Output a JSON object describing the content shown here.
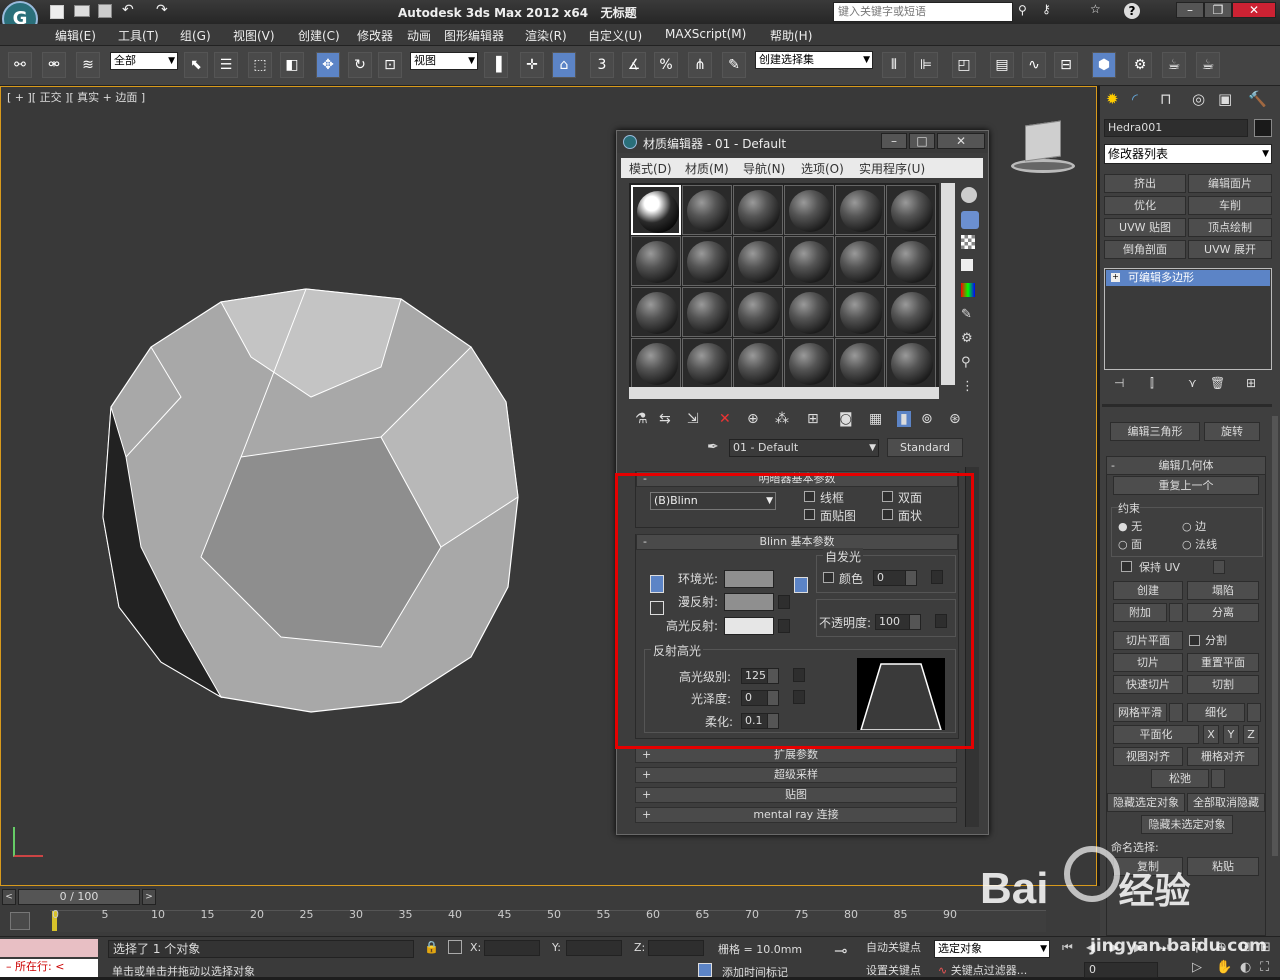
{
  "titlebar": {
    "title": "Autodesk 3ds Max  2012 x64",
    "file": "无标题",
    "search_placeholder": "键入关键字或短语",
    "help": "?"
  },
  "menu": [
    "编辑(E)",
    "工具(T)",
    "组(G)",
    "视图(V)",
    "创建(C)",
    "修改器",
    "动画",
    "图形编辑器",
    "渲染(R)",
    "自定义(U)",
    "MAXScript(M)",
    "帮助(H)"
  ],
  "toolbar": {
    "selection_filter": "全部",
    "ref_coord": "视图",
    "named_set": "创建选择集",
    "snap3": "3",
    "snap_pct": "%"
  },
  "viewport": {
    "label": "[ + ][ 正交 ][ 真实 + 边面 ]"
  },
  "mat_editor": {
    "title": "材质编辑器 - 01 - Default",
    "menu": [
      "模式(D)",
      "材质(M)",
      "导航(N)",
      "选项(O)",
      "实用程序(U)"
    ],
    "material_name": "01 - Default",
    "material_type": "Standard",
    "rollout_shader": "明暗器基本参数",
    "shader": "(B)Blinn",
    "wire": "线框",
    "two_sided": "双面",
    "face_map": "面贴图",
    "faceted": "面状",
    "rollout_blinn": "Blinn 基本参数",
    "self_illum": "自发光",
    "color": "颜色",
    "color_val": "0",
    "ambient": "环境光:",
    "diffuse": "漫反射:",
    "specular": "高光反射:",
    "opacity": "不透明度:",
    "opacity_val": "100",
    "spec_highlights": "反射高光",
    "spec_level": "高光级别:",
    "spec_level_val": "125",
    "gloss": "光泽度:",
    "gloss_val": "0",
    "soften": "柔化:",
    "soften_val": "0.1",
    "rollouts": [
      "扩展参数",
      "超级采样",
      "贴图",
      "mental ray 连接"
    ],
    "colors": {
      "ambient": "#8f8f8f",
      "diffuse": "#8f8f8f",
      "specular": "#e6e6e6"
    }
  },
  "right_panel": {
    "object_name": "Hedra001",
    "modifier_list": "修改器列表",
    "buttons": [
      "挤出",
      "编辑面片",
      "优化",
      "车削",
      "UVW 贴图",
      "顶点绘制",
      "倒角剖面",
      "UVW 展开"
    ],
    "stack_item": "可编辑多边形",
    "edit_tri": "编辑三角形",
    "rotate": "旋转",
    "edit_geo": "编辑几何体",
    "repeat_last": "重复上一个",
    "constraints": "约束",
    "none": "无",
    "edge": "边",
    "face": "面",
    "normal": "法线",
    "preserve_uv": "保持 UV",
    "create": "创建",
    "collapse": "塌陷",
    "attach": "附加",
    "detach": "分离",
    "slice_plane": "切片平面",
    "split": "分割",
    "slice": "切片",
    "reset_plane": "重置平面",
    "quickslice": "快速切片",
    "cut": "切割",
    "meshsmooth": "网格平滑",
    "tessellate": "细化",
    "make_planar": "平面化",
    "x": "X",
    "y": "Y",
    "z": "Z",
    "view_align": "视图对齐",
    "grid_align": "栅格对齐",
    "relax": "松弛",
    "hide_sel": "隐藏选定对象",
    "unhide_all": "全部取消隐藏",
    "hide_unsel": "隐藏未选定对象",
    "named_sel": "命名选择:",
    "copy": "复制",
    "paste": "粘贴"
  },
  "timeline": {
    "frame": "0 / 100",
    "ticks": [
      "0",
      "5",
      "10",
      "15",
      "20",
      "25",
      "30",
      "35",
      "40",
      "45",
      "50",
      "55",
      "60",
      "65",
      "70",
      "75",
      "80",
      "85",
      "90"
    ]
  },
  "status": {
    "selected": "选择了 1 个对象",
    "prompt": "单击或单击并拖动以选择对象",
    "where": "所在行:",
    "x": "X:",
    "y": "Y:",
    "z": "Z:",
    "grid": "栅格 = 10.0mm",
    "autokey": "自动关键点",
    "selected_obj": "选定对象",
    "set_key": "设置关键点",
    "key_filters": "关键点过滤器...",
    "add_time_tag": "添加时间标记",
    "frame_val": "0"
  },
  "watermark": {
    "brand": "Bai",
    "brand2": "经验",
    "url": "jingyan.baidu.com"
  }
}
